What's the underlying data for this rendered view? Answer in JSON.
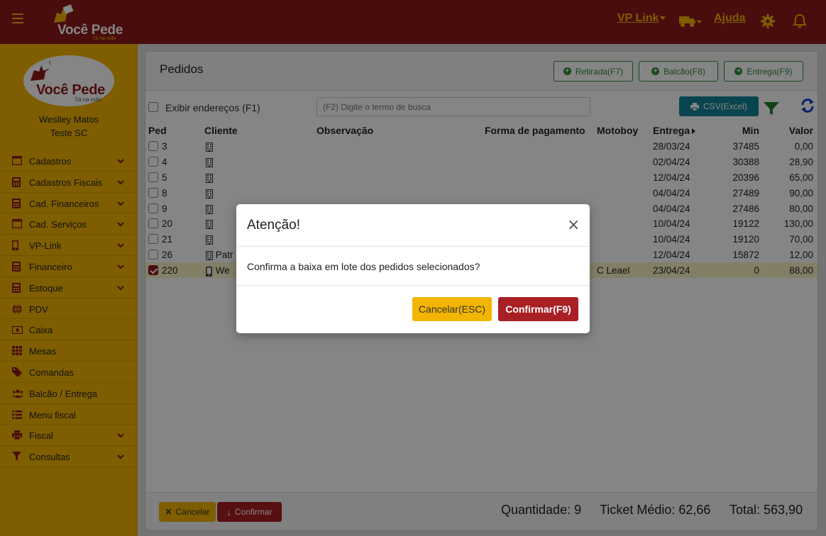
{
  "header": {
    "brand": "Você Pede",
    "tagline": "Tá na mão",
    "nav_vplink": "VP Link",
    "nav_ajuda": "Ajuda",
    "icons": [
      "menu-icon",
      "truck-icon",
      "gear-icon",
      "bell-icon"
    ],
    "colors": {
      "bar": "#8d1a1c",
      "accent": "#f2b500"
    }
  },
  "sidebar": {
    "brand": "Você Pede",
    "tagline": "Tá na mão",
    "user_name": "Weslley Matos",
    "company": "Teste SC",
    "items": [
      {
        "label": "Cadastros",
        "icon": "window-icon",
        "expandable": true
      },
      {
        "label": "Cadastros Fiscais",
        "icon": "calculator-icon",
        "expandable": true
      },
      {
        "label": "Cad. Financeiros",
        "icon": "calculator-icon",
        "expandable": true
      },
      {
        "label": "Cad. Serviços",
        "icon": "window-icon",
        "expandable": true
      },
      {
        "label": "VP-Link",
        "icon": "mobile-icon",
        "expandable": true
      },
      {
        "label": "Financeiro",
        "icon": "calculator-icon",
        "expandable": true
      },
      {
        "label": "Estoque",
        "icon": "calculator-icon",
        "expandable": true
      },
      {
        "label": "PDV",
        "icon": "globe-icon",
        "expandable": false
      },
      {
        "label": "Caixa",
        "icon": "cash-icon",
        "expandable": false
      },
      {
        "label": "Mesas",
        "icon": "grid-icon",
        "expandable": false
      },
      {
        "label": "Comandas",
        "icon": "tag-icon",
        "expandable": false
      },
      {
        "label": "Balcão / Entrega",
        "icon": "users-icon",
        "expandable": false
      },
      {
        "label": "Menu fiscal",
        "icon": "list-icon",
        "expandable": false
      },
      {
        "label": "Fiscal",
        "icon": "printer-icon",
        "expandable": true
      },
      {
        "label": "Consultas",
        "icon": "filter-icon",
        "expandable": true
      }
    ]
  },
  "page": {
    "title": "Pedidos",
    "btn_retirada": "Retirada(F7)",
    "btn_balcao": "Balcão(F8)",
    "btn_entrega": "Entrega(F9)",
    "show_addresses_label": "Exibir endereços (F1)",
    "search_placeholder": "(F2) Digite o termo de busca",
    "csv_label": "CSV(Excel)"
  },
  "table": {
    "columns": [
      "Ped",
      "Cliente",
      "Observação",
      "Forma de pagamento",
      "Motoboy",
      "Entrega",
      "Min",
      "Valor"
    ],
    "rows": [
      {
        "ped": "3",
        "cliente_icon": "building-icon",
        "cliente": "",
        "obs": "",
        "pagamento": "",
        "motoboy": "",
        "entrega": "28/03/24",
        "min": "37485",
        "valor": "0,00",
        "checked": false
      },
      {
        "ped": "4",
        "cliente_icon": "building-icon",
        "cliente": "",
        "obs": "",
        "pagamento": "",
        "motoboy": "",
        "entrega": "02/04/24",
        "min": "30388",
        "valor": "28,90",
        "checked": false
      },
      {
        "ped": "5",
        "cliente_icon": "building-icon",
        "cliente": "",
        "obs": "",
        "pagamento": "",
        "motoboy": "",
        "entrega": "12/04/24",
        "min": "20396",
        "valor": "65,00",
        "checked": false
      },
      {
        "ped": "8",
        "cliente_icon": "building-icon",
        "cliente": "",
        "obs": "",
        "pagamento": "",
        "motoboy": "",
        "entrega": "04/04/24",
        "min": "27489",
        "valor": "90,00",
        "checked": false
      },
      {
        "ped": "9",
        "cliente_icon": "building-icon",
        "cliente": "",
        "obs": "",
        "pagamento": "",
        "motoboy": "",
        "entrega": "04/04/24",
        "min": "27486",
        "valor": "80,00",
        "checked": false
      },
      {
        "ped": "20",
        "cliente_icon": "building-icon",
        "cliente": "",
        "obs": "",
        "pagamento": "",
        "motoboy": "",
        "entrega": "10/04/24",
        "min": "19122",
        "valor": "130,00",
        "checked": false
      },
      {
        "ped": "21",
        "cliente_icon": "building-icon",
        "cliente": "",
        "obs": "",
        "pagamento": "",
        "motoboy": "",
        "entrega": "10/04/24",
        "min": "19120",
        "valor": "70,00",
        "checked": false
      },
      {
        "ped": "26",
        "cliente_icon": "building-icon",
        "cliente": "Patr",
        "obs": "",
        "pagamento": "",
        "motoboy": "",
        "entrega": "12/04/24",
        "min": "15872",
        "valor": "12,00",
        "checked": false
      },
      {
        "ped": "220",
        "cliente_icon": "mobile-icon",
        "cliente": "We",
        "obs": "",
        "pagamento": "",
        "motoboy": "C Leael",
        "entrega": "23/04/24",
        "min": "0",
        "valor": "88,00",
        "checked": true
      }
    ]
  },
  "footer": {
    "cancel_label": "Cancelar",
    "confirm_label": "Confirmar",
    "quantidade": "Quantidade: 9",
    "ticket": "Ticket Médio: 62,66",
    "total": "Total: 563,90"
  },
  "modal": {
    "title": "Atenção!",
    "close_glyph": "×",
    "message": "Confirma a baixa em lote dos pedidos selecionados?",
    "cancel_label": "Cancelar(ESC)",
    "confirm_label": "Confirmar(F9)"
  }
}
